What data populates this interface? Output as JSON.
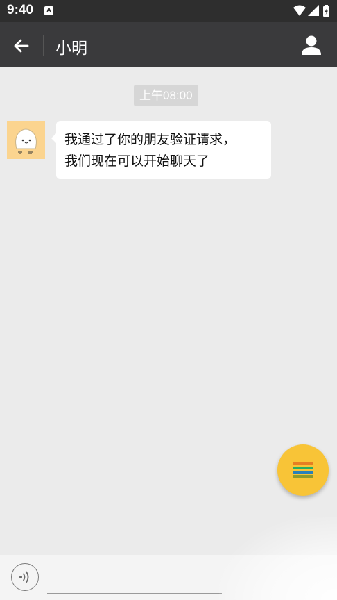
{
  "status_bar": {
    "time": "9:40",
    "notification_icon": "a-icon",
    "icons": [
      "wifi-icon",
      "signal-icon",
      "battery-icon"
    ]
  },
  "app_bar": {
    "title": "小明",
    "back_icon": "arrow-left-icon",
    "profile_icon": "person-icon",
    "background": "#3a3a3c"
  },
  "chat": {
    "background": "#ebebeb",
    "timestamp": "上午08:00",
    "messages": [
      {
        "sender": "friend",
        "avatar_icon": "cartoon-bun-avatar",
        "lines": [
          "我通过了你的朋友验证请求，",
          "我们现在可以开始聊天了"
        ]
      }
    ]
  },
  "fab": {
    "icon": "menu-lines-icon",
    "color": "#f8c437"
  },
  "input_bar": {
    "voice_icon": "voice-icon",
    "input_value": ""
  }
}
